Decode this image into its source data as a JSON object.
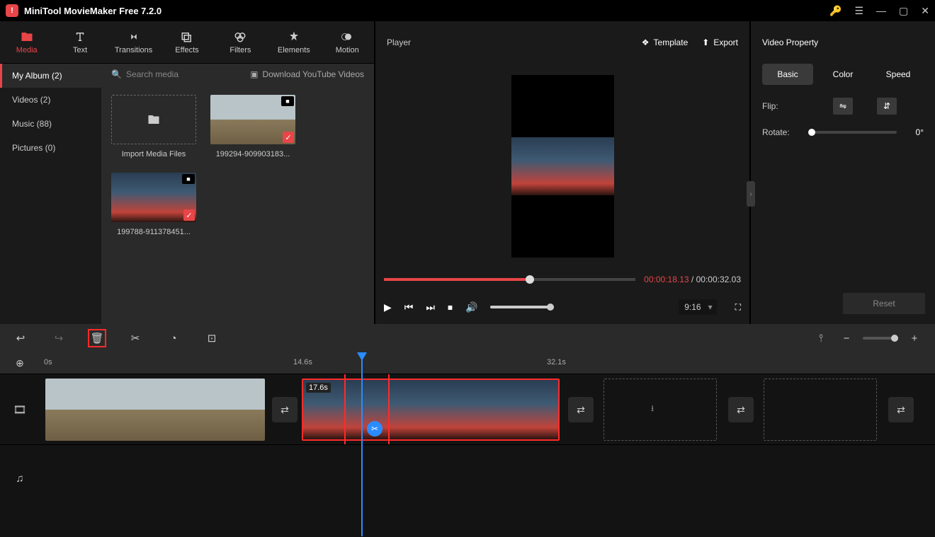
{
  "title": "MiniTool MovieMaker Free 7.2.0",
  "tabs": [
    "Media",
    "Text",
    "Transitions",
    "Effects",
    "Filters",
    "Elements",
    "Motion"
  ],
  "sidebar": [
    "My Album (2)",
    "Videos (2)",
    "Music (88)",
    "Pictures (0)"
  ],
  "search_placeholder": "Search media",
  "download_label": "Download YouTube Videos",
  "thumbs": {
    "import": "Import Media Files",
    "v1": "199294-909903183...",
    "v2": "199788-911378451..."
  },
  "player": {
    "label": "Player",
    "template": "Template",
    "export": "Export",
    "cur": "00:00:18.13",
    "tot": "00:00:32.03",
    "ratio": "9:16"
  },
  "props": {
    "label": "Video Property",
    "tabs": [
      "Basic",
      "Color",
      "Speed"
    ],
    "flip": "Flip:",
    "rotate": "Rotate:",
    "rotate_val": "0°",
    "reset": "Reset"
  },
  "ruler": {
    "t0": "0s",
    "t1": "14.6s",
    "t2": "32.1s"
  },
  "clip2_dur": "17.6s"
}
